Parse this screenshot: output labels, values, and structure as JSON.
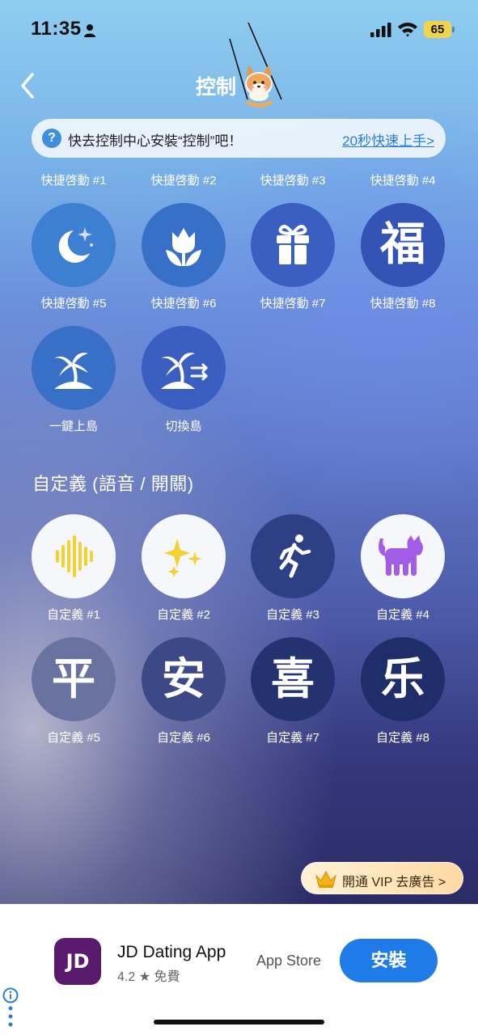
{
  "status_bar": {
    "time": "11:35",
    "battery": "65"
  },
  "nav": {
    "title": "控制"
  },
  "banner": {
    "help_glyph": "?",
    "text": "快去控制中心安裝“控制”吧！",
    "link": "20秒快速上手>"
  },
  "top_labels": [
    "快捷啓動 #1",
    "快捷啓動 #2",
    "快捷啓動 #3",
    "快捷啓動 #4"
  ],
  "shortcuts": [
    {
      "label": "快捷啓動 #5",
      "icon": "moon-stars-icon"
    },
    {
      "label": "快捷啓動 #6",
      "icon": "tulip-icon"
    },
    {
      "label": "快捷啓動 #7",
      "icon": "gift-icon"
    },
    {
      "label": "快捷啓動 #8",
      "icon": "fu-character-icon",
      "glyph": "福"
    },
    {
      "label": "一鍵上島",
      "icon": "palm-island-icon"
    },
    {
      "label": "切換島",
      "icon": "palm-island-switch-icon"
    }
  ],
  "custom_section": {
    "title": "自定義 (語音 / 開關)",
    "items": [
      {
        "label": "自定義 #1",
        "icon": "voice-wave-icon"
      },
      {
        "label": "自定義 #2",
        "icon": "sparkles-icon"
      },
      {
        "label": "自定義 #3",
        "icon": "running-person-icon"
      },
      {
        "label": "自定義 #4",
        "icon": "cat-icon"
      },
      {
        "label": "自定義 #5",
        "icon": "ping-character-icon",
        "glyph": "平"
      },
      {
        "label": "自定義 #6",
        "icon": "an-character-icon",
        "glyph": "安"
      },
      {
        "label": "自定義 #7",
        "icon": "xi-character-icon",
        "glyph": "喜"
      },
      {
        "label": "自定義 #8",
        "icon": "le-character-icon",
        "glyph": "乐"
      }
    ]
  },
  "vip": {
    "label": "開通 VIP 去廣告 >"
  },
  "ad": {
    "app_icon_text": "JD",
    "app_name": "JD Dating App",
    "rating": "4.2 ★  免費",
    "store": "App Store",
    "install": "安裝"
  },
  "colors": {
    "accent": "#1f7be8",
    "link": "#2a7ed6",
    "icon_yellow": "#f2d233",
    "icon_purple": "#a25de6"
  }
}
